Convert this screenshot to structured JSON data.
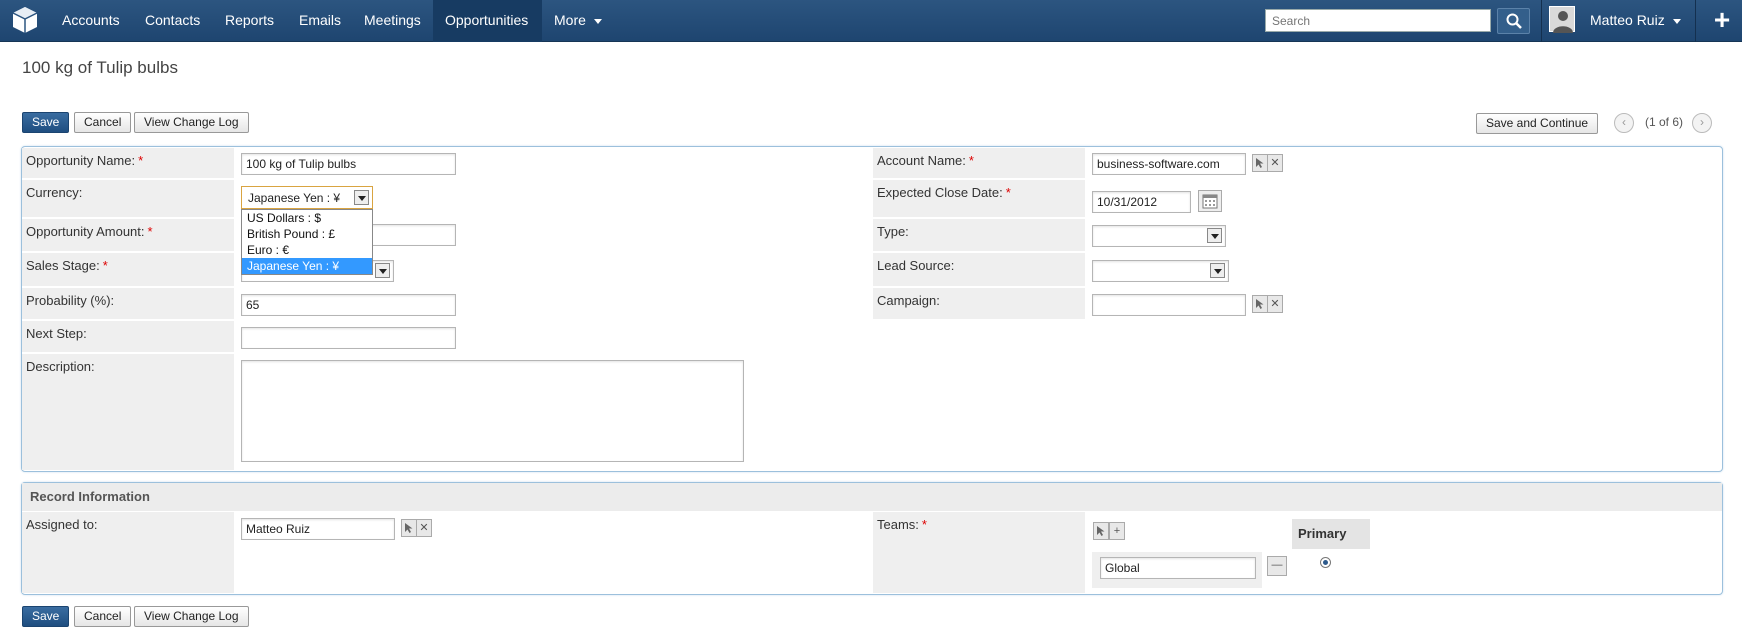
{
  "nav": {
    "items": [
      "Accounts",
      "Contacts",
      "Reports",
      "Emails",
      "Meetings",
      "Opportunities",
      "More"
    ],
    "active": "Opportunities",
    "search_placeholder": "Search",
    "user_name": "Matteo Ruiz"
  },
  "page": {
    "title": "100 kg of Tulip bulbs"
  },
  "buttons": {
    "save": "Save",
    "cancel": "Cancel",
    "view_change_log": "View Change Log",
    "save_and_continue": "Save and Continue"
  },
  "pager": {
    "text": "(1 of 6)"
  },
  "form": {
    "opportunity_name": {
      "label": "Opportunity Name:",
      "value": "100 kg of Tulip bulbs",
      "required": true
    },
    "currency": {
      "label": "Currency:",
      "value": "Japanese Yen : ¥",
      "options": [
        "US Dollars : $",
        "British Pound : £",
        "Euro : €",
        "Japanese Yen : ¥"
      ],
      "highlighted": "Japanese Yen : ¥"
    },
    "opportunity_amount": {
      "label": "Opportunity Amount:",
      "value": "",
      "required": true
    },
    "sales_stage": {
      "label": "Sales Stage:",
      "value": "",
      "required": true
    },
    "probability": {
      "label": "Probability (%):",
      "value": "65"
    },
    "next_step": {
      "label": "Next Step:",
      "value": ""
    },
    "description": {
      "label": "Description:",
      "value": ""
    },
    "account_name": {
      "label": "Account Name:",
      "value": "business-software.com",
      "required": true
    },
    "expected_close_date": {
      "label": "Expected Close Date:",
      "value": "10/31/2012",
      "required": true
    },
    "type": {
      "label": "Type:",
      "value": ""
    },
    "lead_source": {
      "label": "Lead Source:",
      "value": ""
    },
    "campaign": {
      "label": "Campaign:",
      "value": ""
    }
  },
  "record_info": {
    "title": "Record Information",
    "assigned_to": {
      "label": "Assigned to:",
      "value": "Matteo Ruiz"
    },
    "teams": {
      "label": "Teams:",
      "required": true,
      "primary_header": "Primary",
      "team_value": "Global"
    }
  },
  "colors": {
    "nav_bg": "#2c5580",
    "primary_button": "#1f4e80",
    "required": "#dd0000",
    "highlight": "#3399ff"
  }
}
